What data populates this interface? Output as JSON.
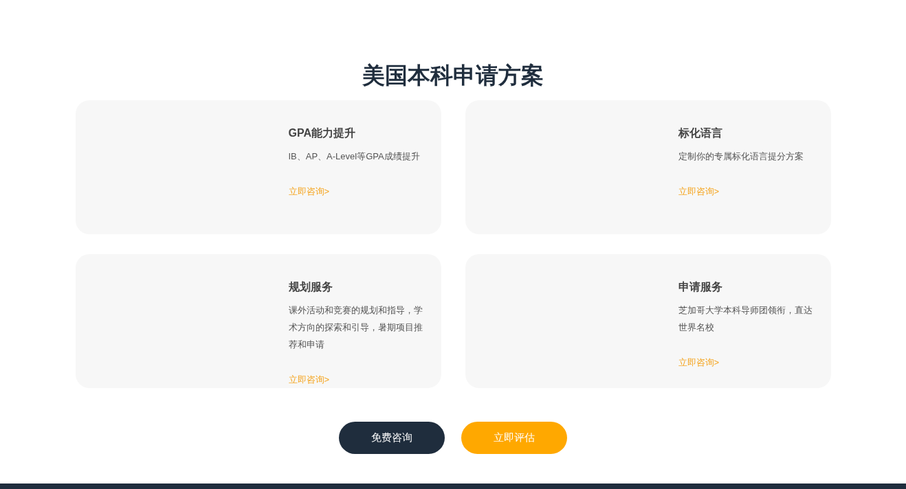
{
  "heading": "美国本科申请方案",
  "cards": [
    {
      "title": "GPA能力提升",
      "description": "IB、AP、A-Level等GPA成绩提升",
      "link": "立即咨询>"
    },
    {
      "title": "标化语言",
      "description": "定制你的专属标化语言提分方案",
      "link": "立即咨询>"
    },
    {
      "title": "规划服务",
      "description": "课外活动和竞赛的规划和指导，学术方向的探索和引导，暑期项目推荐和申请",
      "link": "立即咨询>"
    },
    {
      "title": "申请服务",
      "description": "芝加哥大学本科导师团领衔，直达世界名校",
      "link": "立即咨询>"
    }
  ],
  "buttons": [
    {
      "label": "免费咨询",
      "kind": "dark"
    },
    {
      "label": "立即评估",
      "kind": "accent"
    }
  ]
}
